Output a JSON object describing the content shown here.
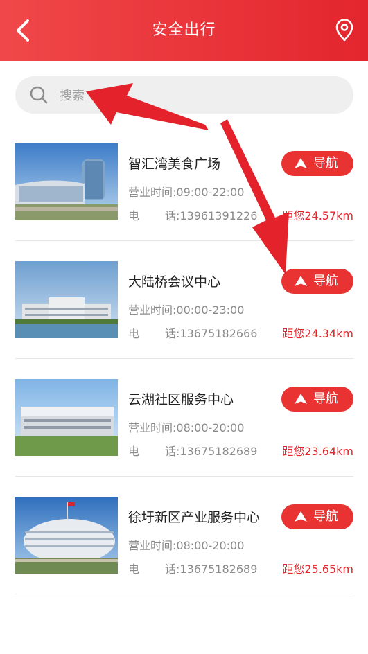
{
  "header": {
    "title": "安全出行",
    "back_icon": "back-arrow-icon",
    "location_icon": "location-pin-icon"
  },
  "search": {
    "placeholder": "搜索",
    "icon": "search-icon"
  },
  "places": [
    {
      "name": "智汇湾美食广场",
      "hours": "营业时间:09:00-22:00",
      "phone_label": "电",
      "phone": "话:13961391226",
      "distance": "距您24.57km",
      "nav_label": "导航"
    },
    {
      "name": "大陆桥会议中心",
      "hours": "营业时间:00:00-23:00",
      "phone_label": "电",
      "phone": "话:13675182666",
      "distance": "距您24.34km",
      "nav_label": "导航"
    },
    {
      "name": "云湖社区服务中心",
      "hours": "营业时间:08:00-20:00",
      "phone_label": "电",
      "phone": "话:13675182689",
      "distance": "距您23.64km",
      "nav_label": "导航"
    },
    {
      "name": "徐圩新区产业服务中心",
      "hours": "营业时间:08:00-20:00",
      "phone_label": "电",
      "phone": "话:13675182689",
      "distance": "距您25.65km",
      "nav_label": "导航"
    }
  ],
  "colors": {
    "accent": "#e93232",
    "distance": "#e2242b",
    "annotation_arrow": "#e3222b"
  }
}
